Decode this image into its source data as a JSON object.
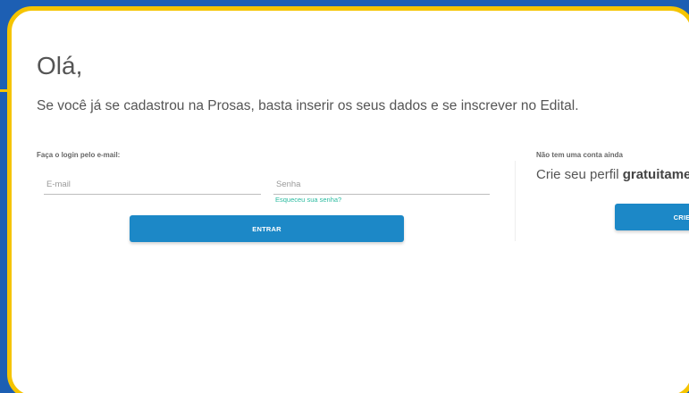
{
  "page": {
    "greeting": "Olá,",
    "intro": "Se você já se cadastrou na Prosas, basta inserir os seus dados e se inscrever no Edital."
  },
  "login": {
    "label": "Faça o login pelo e-mail:",
    "email_placeholder": "E-mail",
    "email_value": "",
    "password_placeholder": "Senha",
    "password_value": "",
    "forgot_link": "Esqueceu sua senha?",
    "submit_label": "ENTRAR"
  },
  "signup": {
    "label": "Não tem uma conta ainda",
    "headline_prefix": "Crie seu perfil ",
    "headline_bold": "gratuitame",
    "button_label": "CRIE"
  },
  "colors": {
    "background": "#1d5fb3",
    "frame": "#f5c400",
    "button": "#1c88c7",
    "link": "#2bbba0"
  }
}
